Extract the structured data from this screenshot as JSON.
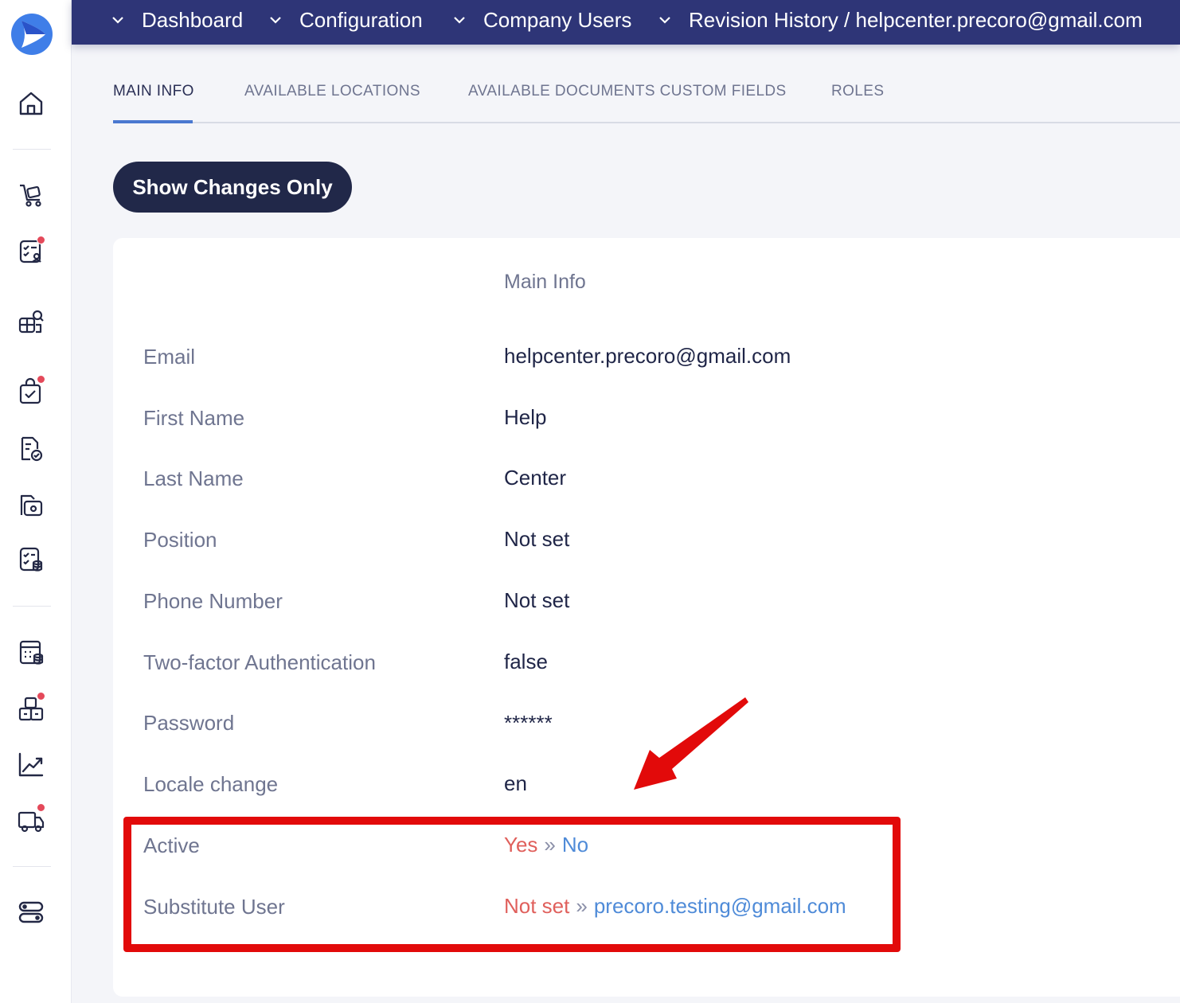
{
  "breadcrumbs": [
    {
      "label": "Dashboard"
    },
    {
      "label": "Configuration"
    },
    {
      "label": "Company Users"
    },
    {
      "label": "Revision History / helpcenter.precoro@gmail.com"
    }
  ],
  "tabs": [
    {
      "label": "MAIN INFO",
      "active": true
    },
    {
      "label": "AVAILABLE LOCATIONS",
      "active": false
    },
    {
      "label": "AVAILABLE DOCUMENTS CUSTOM FIELDS",
      "active": false
    },
    {
      "label": "ROLES",
      "active": false
    }
  ],
  "toolbar": {
    "show_changes_label": "Show Changes Only"
  },
  "section": {
    "title": "Main Info"
  },
  "fields": [
    {
      "label": "Email",
      "value": "helpcenter.precoro@gmail.com"
    },
    {
      "label": "First Name",
      "value": "Help"
    },
    {
      "label": "Last Name",
      "value": "Center"
    },
    {
      "label": "Position",
      "value": "Not set"
    },
    {
      "label": "Phone Number",
      "value": "Not set"
    },
    {
      "label": "Two-factor Authentication",
      "value": "false"
    },
    {
      "label": "Password",
      "value": "******"
    },
    {
      "label": "Locale change",
      "value": "en"
    }
  ],
  "changed_fields": [
    {
      "label": "Active",
      "old": "Yes",
      "separator": "»",
      "new": "No"
    },
    {
      "label": "Substitute User",
      "old": "Not set",
      "separator": "»",
      "new": "precoro.testing@gmail.com"
    }
  ],
  "sidebar": {
    "icons": [
      {
        "name": "home-icon"
      },
      {
        "name": "purchase-cart-icon"
      },
      {
        "name": "approval-list-icon",
        "badge": true
      },
      {
        "name": "supplier-search-icon"
      },
      {
        "name": "bag-check-icon",
        "badge": true
      },
      {
        "name": "document-check-icon"
      },
      {
        "name": "wallet-folder-icon"
      },
      {
        "name": "checklist-database-icon"
      },
      {
        "name": "budget-calculator-icon"
      },
      {
        "name": "inventory-boxes-icon",
        "badge": true
      },
      {
        "name": "analytics-chart-icon"
      },
      {
        "name": "delivery-truck-icon",
        "badge": true
      },
      {
        "name": "settings-toggle-icon"
      }
    ]
  },
  "colors": {
    "topbar": "#2e3577",
    "old_value": "#e0605c",
    "new_value": "#4f8bd8",
    "highlight": "#e20a0a",
    "badge": "#e4495a",
    "button": "#212849"
  }
}
